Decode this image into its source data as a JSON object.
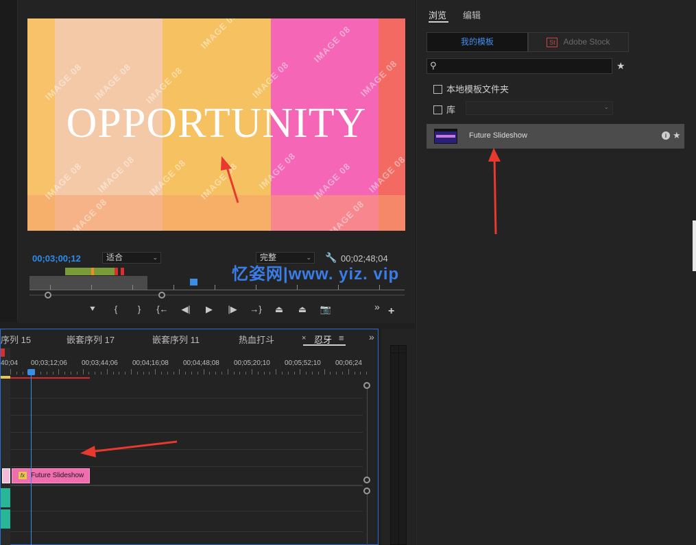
{
  "program_monitor": {
    "video_title": "OPPORTUNITY",
    "watermark": "IMAGE 08",
    "timecode_current": "00;03;00;12",
    "zoom_select": "适合",
    "quality_select": "完整",
    "timecode_duration": "00;02;48;04"
  },
  "site_watermark": "忆姿网|www. yiz. vip",
  "timeline": {
    "tabs": [
      "序列 15",
      "嵌套序列 17",
      "嵌套序列 11",
      "热血打斗",
      "忍牙"
    ],
    "close_glyph": "×",
    "menu_glyph": "≡",
    "expand_glyph": "»",
    "ruler_times": [
      "40;04",
      "00;03;12;06",
      "00;03;44;06",
      "00;04;16;08",
      "00;04;48;08",
      "00;05;20;10",
      "00;05;52;10",
      "00;06;24"
    ],
    "clip_label": "Future Slideshow",
    "fx_label": "fx"
  },
  "essential_graphics": {
    "tabs": [
      "浏览",
      "编辑"
    ],
    "my_templates": "我的模板",
    "adobe_stock": "Adobe Stock",
    "stock_badge": "St",
    "local_folder_label": "本地模板文件夹",
    "library_label": "库",
    "template_item": "Future Slideshow",
    "info_glyph": "i",
    "star_glyph": "★",
    "search_glyph": "⚲"
  },
  "icons": {
    "wrench": "🔧",
    "marker": "⯆",
    "in_point": "{",
    "out_point": "}",
    "go_to_in": "{←",
    "step_back": "◀|",
    "play": "▶",
    "step_forward": "|▶",
    "go_to_out": "→}",
    "lift": "⏏",
    "extract": "⏏",
    "export_frame": "📷",
    "more": "»",
    "add": "+"
  },
  "colors": {
    "accent_blue": "#2d8ceb",
    "clip_pink": "#f06db0",
    "arrow_red": "#e8392f",
    "panel_bg": "#232323"
  }
}
